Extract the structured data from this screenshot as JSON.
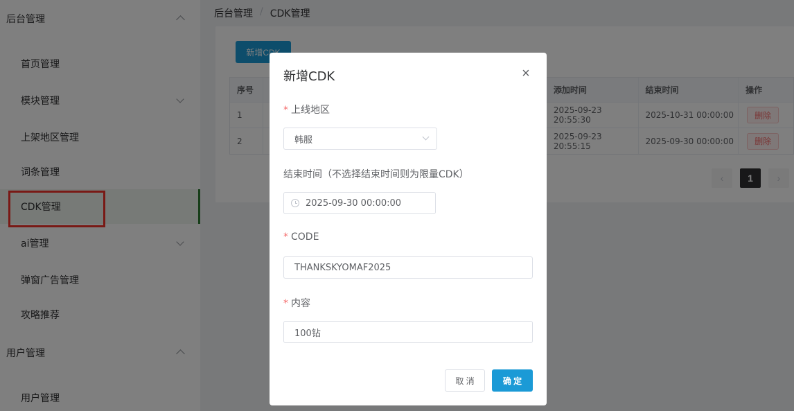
{
  "sidebar": {
    "group1": "后台管理",
    "items": [
      {
        "label": "首页管理"
      },
      {
        "label": "模块管理"
      },
      {
        "label": "上架地区管理"
      },
      {
        "label": "词条管理"
      },
      {
        "label": "CDK管理"
      },
      {
        "label": "ai管理"
      },
      {
        "label": "弹窗广告管理"
      },
      {
        "label": "攻略推荐"
      }
    ],
    "group2": "用户管理",
    "group2_items": [
      {
        "label": "用户管理"
      }
    ]
  },
  "breadcrumb": {
    "root": "后台管理",
    "sep": "/",
    "current": "CDK管理"
  },
  "toolbar": {
    "add_label": "新增CDK"
  },
  "table": {
    "headers": [
      "序号",
      "",
      "添加时间",
      "结束时间",
      "操作"
    ],
    "rows": [
      {
        "index": "1",
        "added": "2025-09-23 20:55:30",
        "end": "2025-10-31 00:00:00",
        "action": "删除"
      },
      {
        "index": "2",
        "added": "2025-09-23 20:55:15",
        "end": "2025-09-30 00:00:00",
        "action": "删除"
      }
    ]
  },
  "pagination": {
    "prev": "‹",
    "current": "1",
    "next": "›"
  },
  "dialog": {
    "title": "新增CDK",
    "close": "×",
    "region_label": "上线地区",
    "region_value": "韩服",
    "end_time_label": "结束时间（不选择结束时间则为限量CDK）",
    "end_time_value": "2025-09-30 00:00:00",
    "code_label": "CODE",
    "code_value": "THANKSKYOMAF2025",
    "content_label": "内容",
    "content_value": "100钻",
    "required_mark": "*",
    "cancel_label": "取 消",
    "ok_label": "确 定"
  },
  "colors": {
    "primary": "#1b9ad6",
    "active_border": "#2e7d32",
    "highlight": "#f3322a",
    "danger": "#f56c6c"
  }
}
